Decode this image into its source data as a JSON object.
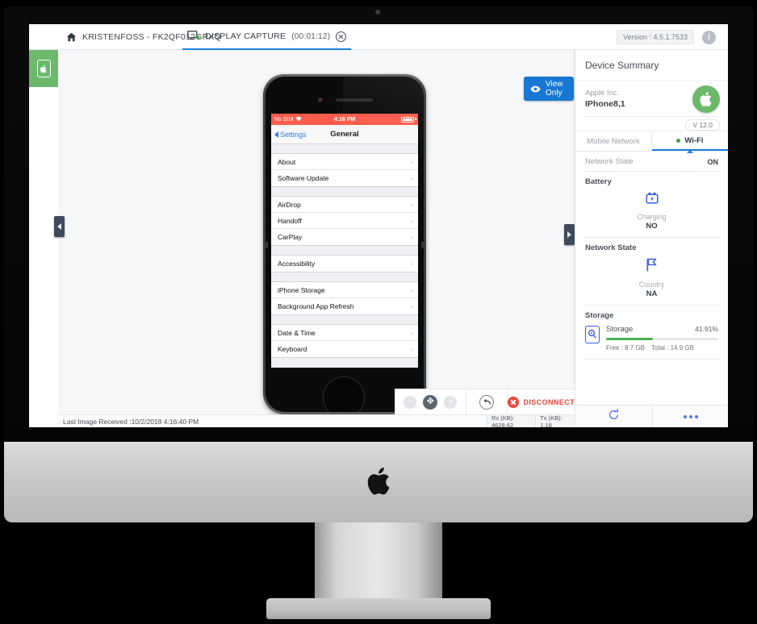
{
  "topbar": {
    "home_tab_label": "KRISTENFOSS - FK2QF012GRXQ",
    "capture_tab_label": "DISPLAY CAPTURE",
    "capture_tab_time": "(00:01:12)",
    "version_label": "Version : 4.5.1.7533",
    "info_glyph": "i",
    "icons": {
      "home": "home-icon",
      "monitor": "display-capture-icon",
      "close": "close-tab-icon",
      "info": "info-icon"
    }
  },
  "stage": {
    "view_only_label": "View Only",
    "last_image_label": "Last Image Received :10/2/2018 4:16:40 PM",
    "rx_label": "Rx (KB): 4628.62",
    "tx_label": "Tx (KB): 1.18"
  },
  "controls": {
    "zoom_out": "−",
    "pan": "✥",
    "zoom_in": "+",
    "undo": "↶",
    "disconnect_label": "DISCONNECT"
  },
  "phone": {
    "status": {
      "carrier": "No SIM",
      "wifi": "▾",
      "time": "4:16 PM"
    },
    "nav": {
      "back_label": "Settings",
      "title": "General"
    },
    "groups": [
      {
        "rows": [
          {
            "label": "About",
            "chevron": "›"
          },
          {
            "label": "Software Update",
            "chevron": "›"
          }
        ]
      },
      {
        "rows": [
          {
            "label": "AirDrop",
            "chevron": "›"
          },
          {
            "label": "Handoff",
            "chevron": "›"
          },
          {
            "label": "CarPlay",
            "chevron": "›"
          }
        ]
      },
      {
        "rows": [
          {
            "label": "Accessibility",
            "chevron": "›"
          }
        ]
      },
      {
        "rows": [
          {
            "label": "iPhone Storage",
            "chevron": "›"
          },
          {
            "label": "Background App Refresh",
            "chevron": "›"
          }
        ]
      },
      {
        "rows": [
          {
            "label": "Date & Time",
            "chevron": "›"
          },
          {
            "label": "Keyboard",
            "chevron": "›"
          }
        ]
      }
    ]
  },
  "panel": {
    "title": "Device Summary",
    "vendor": "Apple Inc.",
    "model": "IPhone8,1",
    "version_prefix": "V",
    "version_value": "12.0",
    "tabs": [
      {
        "label": "Mobile Network",
        "active": false
      },
      {
        "label": "Wi-Fi",
        "active": true
      }
    ],
    "network_state": {
      "key": "Network State",
      "value": "ON"
    },
    "battery": {
      "title": "Battery",
      "metric_label": "Charging",
      "metric_value": "NO"
    },
    "network_state_section": {
      "title": "Network State",
      "metric_label": "Country",
      "metric_value": "NA"
    },
    "storage": {
      "title": "Storage",
      "name": "Storage",
      "percent_label": "41.91%",
      "percent_value": 41.91,
      "free_label": "Free :   8.7 GB",
      "total_label": "Total : 14.9 GB"
    },
    "footer": {
      "refresh": "refresh-icon",
      "more": "more-options-icon"
    }
  },
  "colors": {
    "accent_blue": "#1b7fe0",
    "green": "#6cb96c",
    "red": "#e8463c",
    "ios_status_red": "#fb5c4c",
    "storage_green": "#4caf50"
  }
}
